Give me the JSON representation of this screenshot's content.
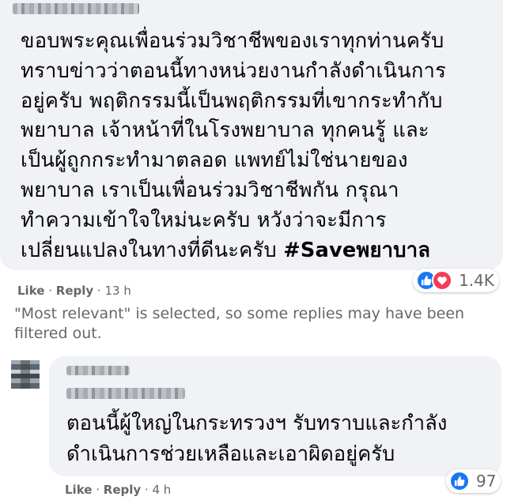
{
  "comment1": {
    "text": "ขอบพระคุณเพื่อนร่วมวิชาชีพของเราทุกท่านครับ\nทราบข่าวว่าตอนนี้ทางหน่วยงานกำลังดำเนินการ\nอยู่ครับ พฤติกรรมนี้เป็นพฤติกรรมที่เขากระทำกับ\nพยาบาล เจ้าหน้าที่ในโรงพยาบาล ทุกคนรู้ และ\nเป็นผู้ถูกกระทำมาตลอด แพทย์ไม่ใช่นายของ\nพยาบาล เราเป็นเพื่อนร่วมวิชาชีพกัน กรุณา\nทำความเข้าใจใหม่นะครับ หวังว่าจะมีการ\nเปลี่ยนแปลงในทางที่ดีนะครับ ",
    "hashtag": "#Saveพยาบาล",
    "like_label": "Like",
    "reply_label": "Reply",
    "time": "13 h",
    "reaction_count": "1.4K",
    "reaction_icons": [
      "like-icon",
      "love-icon"
    ]
  },
  "filter_notice": "\"Most relevant\" is selected, so some replies may have been filtered out.",
  "reply1": {
    "text": "ตอนนี้ผู้ใหญ่ในกระทรวงฯ รับทราบและกำลัง\nดำเนินการช่วยเหลือและเอาผิดอยู่ครับ",
    "like_label": "Like",
    "reply_label": "Reply",
    "time": "4 h",
    "reaction_count": "97",
    "reaction_icons": [
      "like-icon"
    ]
  },
  "colors": {
    "bubble": "#f0f2f5",
    "meta_text": "#65676b",
    "like_blue": "#1877f2",
    "love_red": "#f33e58"
  }
}
